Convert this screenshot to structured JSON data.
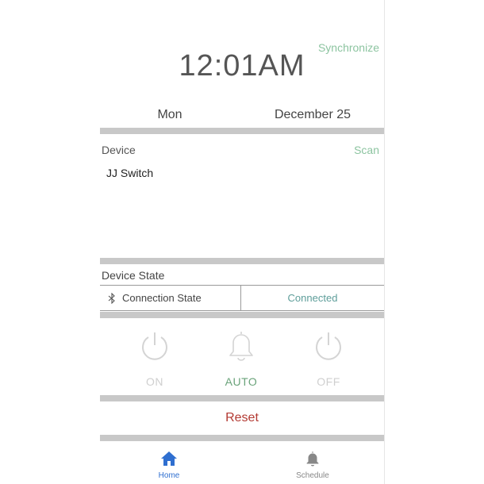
{
  "header": {
    "sync_label": "Synchronize",
    "time": "12:01AM",
    "day": "Mon",
    "date": "December 25"
  },
  "device": {
    "title": "Device",
    "scan_label": "Scan",
    "name": "JJ Switch"
  },
  "device_state": {
    "title": "Device State",
    "connection_label": "Connection State",
    "connection_value": "Connected",
    "connection_icon": "bluetooth-icon"
  },
  "modes": [
    {
      "label": "ON",
      "icon": "power-icon",
      "active": false
    },
    {
      "label": "AUTO",
      "icon": "bell-icon",
      "active": true
    },
    {
      "label": "OFF",
      "icon": "power-icon",
      "active": false
    }
  ],
  "reset_label": "Reset",
  "tabbar": {
    "home_label": "Home",
    "schedule_label": "Schedule",
    "active": "Home"
  },
  "colors": {
    "accent_green": "#8cc4a0",
    "connected_teal": "#5e9e9a",
    "active_mode_green": "#6aa37a",
    "inactive_gray": "#cfcfcf",
    "reset_red": "#b33a33",
    "tab_active_blue": "#2f6fd0",
    "tab_inactive_gray": "#888888",
    "section_band": "#c8c8c8"
  }
}
